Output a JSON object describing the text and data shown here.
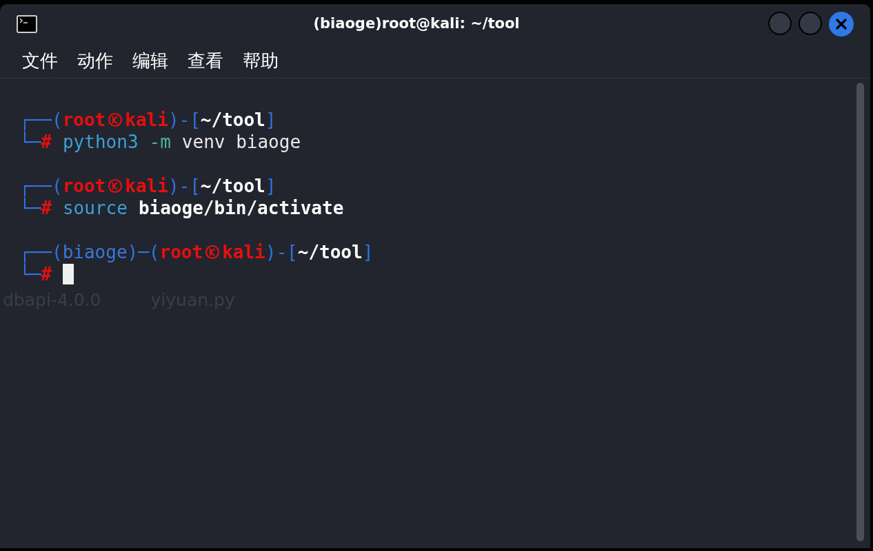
{
  "window": {
    "title": "(biaoge)root@kali: ~/tool"
  },
  "menu": [
    "文件",
    "动作",
    "编辑",
    "查看",
    "帮助"
  ],
  "blocks": [
    {
      "prompt": [
        {
          "text": "┌──(",
          "kind": "frame"
        },
        {
          "text": "root",
          "kind": "user"
        },
        {
          "kind": "mark"
        },
        {
          "text": "kali",
          "kind": "host"
        },
        {
          "text": ")-[",
          "kind": "frame"
        },
        {
          "text": "~/tool",
          "kind": "path"
        },
        {
          "text": "]",
          "kind": "frame"
        }
      ],
      "input": [
        {
          "text": "└─",
          "kind": "frame"
        },
        {
          "text": "#",
          "kind": "hash"
        },
        {
          "text": "python3",
          "kind": "command"
        },
        {
          "text": "-m",
          "kind": "option"
        },
        {
          "text": "venv biaoge",
          "kind": "arg"
        }
      ]
    },
    {
      "prompt": [
        {
          "text": "┌──(",
          "kind": "frame"
        },
        {
          "text": "root",
          "kind": "user"
        },
        {
          "kind": "mark"
        },
        {
          "text": "kali",
          "kind": "host"
        },
        {
          "text": ")-[",
          "kind": "frame"
        },
        {
          "text": "~/tool",
          "kind": "path"
        },
        {
          "text": "]",
          "kind": "frame"
        }
      ],
      "input": [
        {
          "text": "└─",
          "kind": "frame"
        },
        {
          "text": "#",
          "kind": "hash"
        },
        {
          "text": "source",
          "kind": "command"
        },
        {
          "text": "biaoge/bin/activate",
          "kind": "path_arg"
        }
      ]
    },
    {
      "prompt": [
        {
          "text": "┌──(",
          "kind": "frame"
        },
        {
          "text": "biaoge",
          "kind": "venv"
        },
        {
          "text": ")─(",
          "kind": "frame"
        },
        {
          "text": "root",
          "kind": "user"
        },
        {
          "kind": "mark"
        },
        {
          "text": "kali",
          "kind": "host"
        },
        {
          "text": ")-[",
          "kind": "frame"
        },
        {
          "text": "~/tool",
          "kind": "path"
        },
        {
          "text": "]",
          "kind": "frame"
        }
      ],
      "input": [
        {
          "text": "└─",
          "kind": "frame"
        },
        {
          "text": "#",
          "kind": "hash"
        },
        {
          "kind": "cursor"
        }
      ]
    }
  ],
  "desktop_labels": [
    "dbapi-4.0.0",
    "yiyuan.py"
  ]
}
